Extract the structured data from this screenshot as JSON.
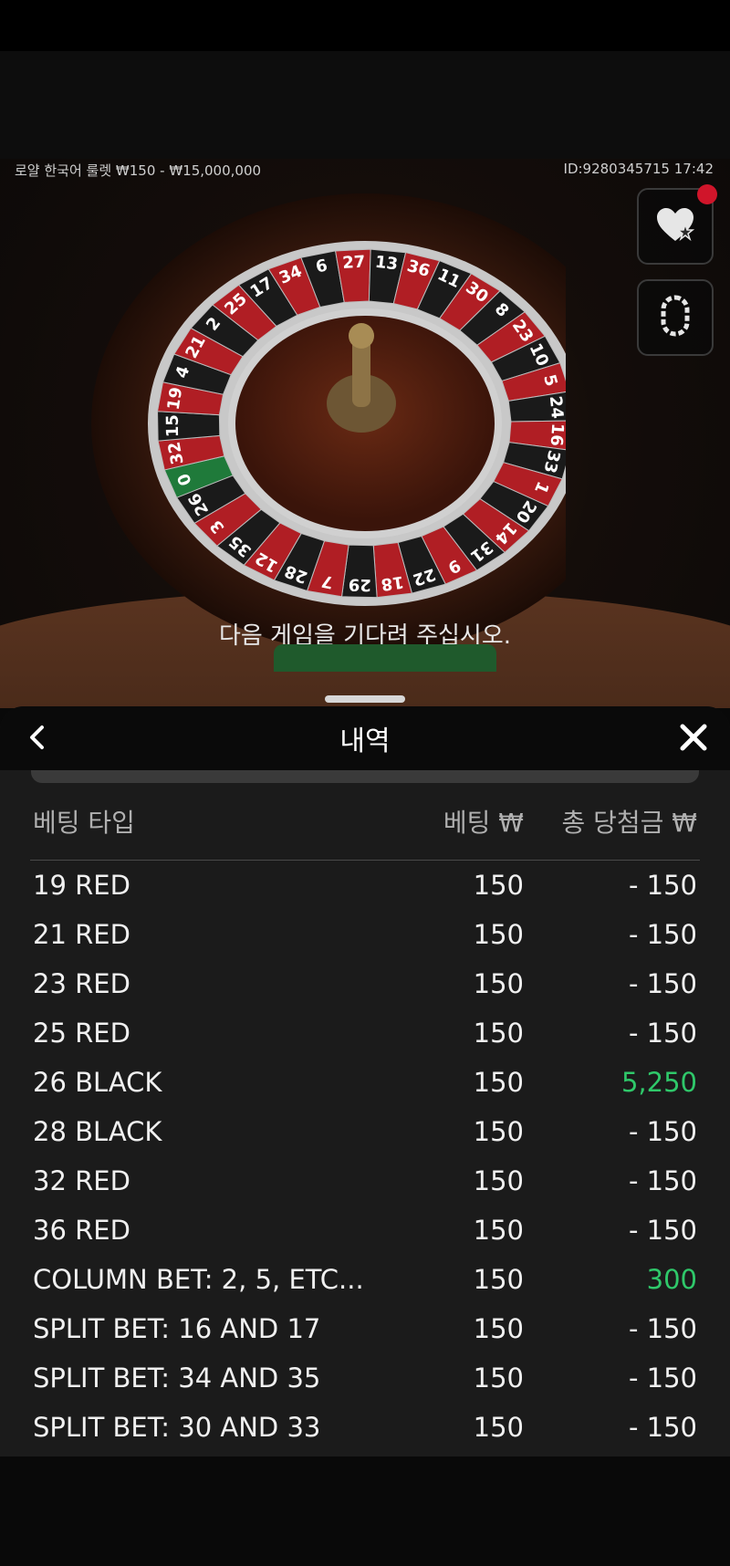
{
  "game": {
    "info_label": "로얄 한국어 룰렛  ₩150 - ₩15,000,000",
    "game_id": "ID:9280345715",
    "time": "17:42",
    "status_message": "다음 게임을 기다려 주십시오.",
    "wheel_numbers": [
      "0",
      "32",
      "15",
      "19",
      "4",
      "21",
      "2",
      "25",
      "17",
      "34",
      "6",
      "27",
      "13",
      "36",
      "11",
      "30",
      "8",
      "23",
      "10",
      "5",
      "24",
      "16",
      "33",
      "1",
      "20",
      "14",
      "31",
      "9",
      "22",
      "18",
      "29",
      "7",
      "28",
      "12",
      "35",
      "3",
      "26"
    ],
    "colors": {
      "red": "#b01e24",
      "black": "#1a1a1a",
      "green": "#1f7a3a"
    }
  },
  "side_buttons": [
    {
      "icon": "heart-star-icon"
    },
    {
      "icon": "racetrack-icon"
    }
  ],
  "panel": {
    "title": "내역",
    "back_icon": "chevron-left-icon",
    "close_icon": "close-icon"
  },
  "table": {
    "headers": {
      "type": "베팅 타입",
      "bet": "베팅 ₩",
      "win": "총 당첨금 ₩"
    },
    "rows": [
      {
        "type": "19 RED",
        "bet": "150",
        "win": "- 150",
        "positive": false
      },
      {
        "type": "21 RED",
        "bet": "150",
        "win": "- 150",
        "positive": false
      },
      {
        "type": "23 RED",
        "bet": "150",
        "win": "- 150",
        "positive": false
      },
      {
        "type": "25 RED",
        "bet": "150",
        "win": "- 150",
        "positive": false
      },
      {
        "type": "26 BLACK",
        "bet": "150",
        "win": "5,250",
        "positive": true
      },
      {
        "type": "28 BLACK",
        "bet": "150",
        "win": "- 150",
        "positive": false
      },
      {
        "type": "32 RED",
        "bet": "150",
        "win": "- 150",
        "positive": false
      },
      {
        "type": "36 RED",
        "bet": "150",
        "win": "- 150",
        "positive": false
      },
      {
        "type": "COLUMN BET: 2, 5, ETC...",
        "bet": "150",
        "win": "300",
        "positive": true
      },
      {
        "type": "SPLIT BET: 16 AND 17",
        "bet": "150",
        "win": "- 150",
        "positive": false
      },
      {
        "type": "SPLIT BET: 34 AND 35",
        "bet": "150",
        "win": "- 150",
        "positive": false
      },
      {
        "type": "SPLIT BET: 30 AND 33",
        "bet": "150",
        "win": "- 150",
        "positive": false
      }
    ]
  }
}
